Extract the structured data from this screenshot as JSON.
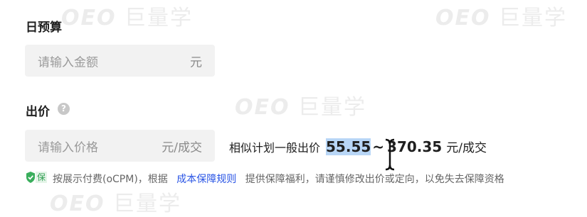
{
  "watermark": {
    "text": "巨量学"
  },
  "budget": {
    "title": "日预算",
    "placeholder": "请输入金额",
    "unit": "元"
  },
  "bid": {
    "title": "出价",
    "help_icon": "question-circle-icon",
    "placeholder": "请输入价格",
    "unit": "元/成交",
    "hint_prefix": "相似计划一般出价",
    "range_low": "55.55",
    "range_sep": "~",
    "range_high": "370.35",
    "range_unit": "元/成交"
  },
  "footnote": {
    "badge_label": "保",
    "badge_icon": "shield-check-icon",
    "before_link": "按展示付费(oCPM)，根据",
    "link_text": "成本保障规则",
    "after_link": "提供保障福利，请谨慎修改出价或定向，以免失去保障资格"
  },
  "colors": {
    "accent": "#2a55e5",
    "selection": "#b8d6f6",
    "input_bg": "#f2f2f2",
    "badge_green": "#2f9e50"
  }
}
